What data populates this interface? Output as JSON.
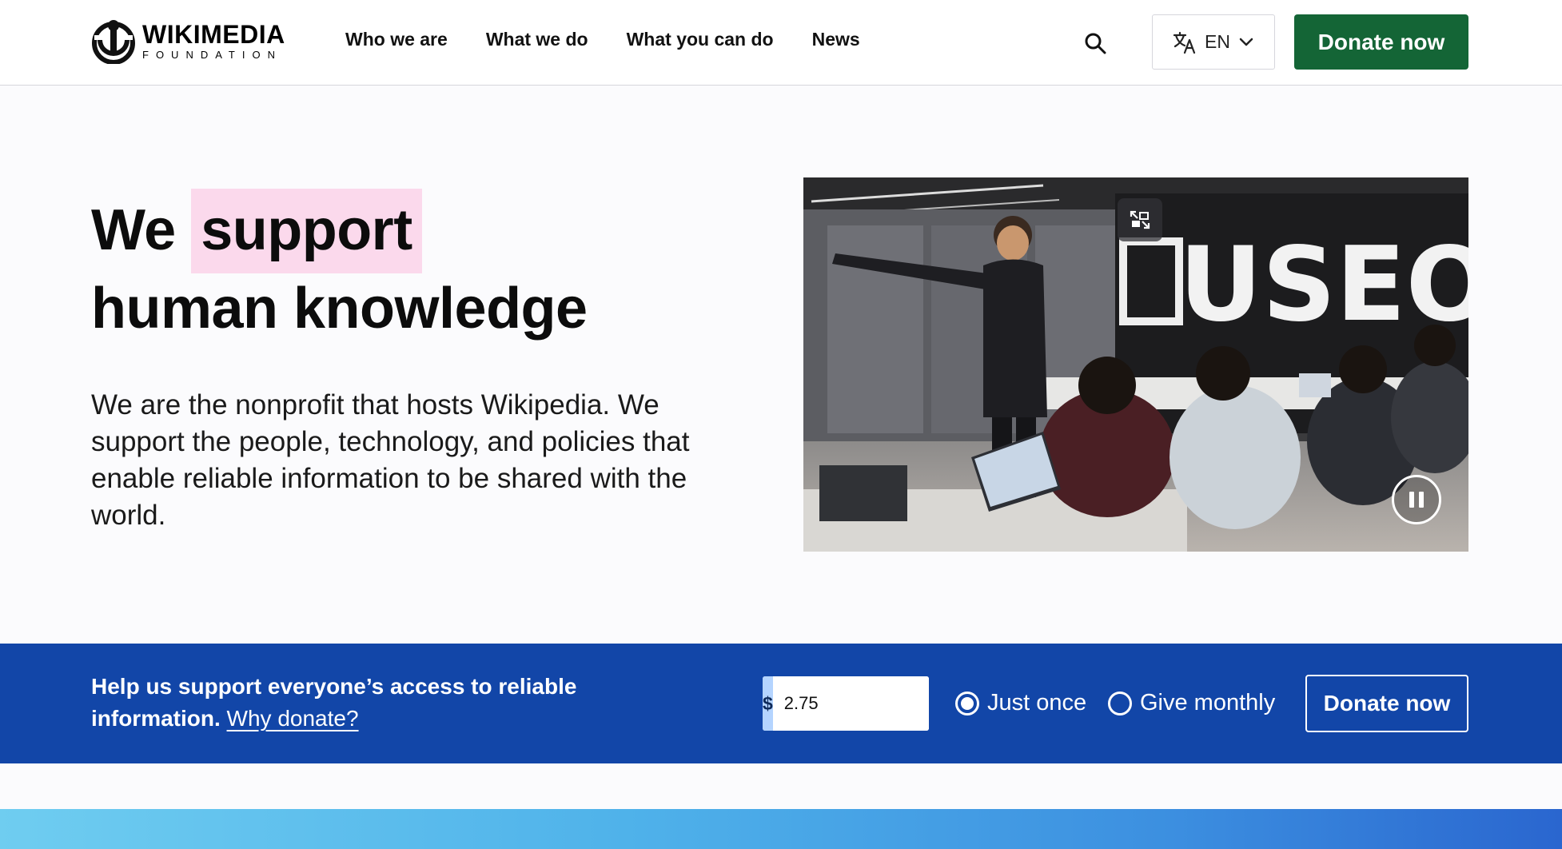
{
  "header": {
    "logo": {
      "name": "WIKIMEDIA",
      "sub": "FOUNDATION"
    },
    "nav": [
      "Who we are",
      "What we do",
      "What you can do",
      "News"
    ],
    "search_icon": "search-icon",
    "language": {
      "code": "EN",
      "icon": "translate-icon",
      "chevron": "chevron-down-icon"
    },
    "donate_label": "Donate now"
  },
  "hero": {
    "title_prefix": "We",
    "title_highlight": "support",
    "title_line2": "human knowledge",
    "description": "We are the nonprofit that hosts Wikipedia. We support the people, technology, and policies that enable reliable information to be shared with the world.",
    "video": {
      "pip_icon": "picture-in-picture-icon",
      "pause_icon": "pause-icon",
      "sign_text": "USEO"
    }
  },
  "banner": {
    "text": "Help us support everyone’s access to reliable information.",
    "link": "Why donate?",
    "currency": "$",
    "amount": "2.75",
    "options": [
      {
        "label": "Just once",
        "selected": true
      },
      {
        "label": "Give monthly",
        "selected": false
      }
    ],
    "donate_label": "Donate now"
  },
  "colors": {
    "donate_green": "#146536",
    "banner_blue": "#1246a8",
    "highlight_pink": "#fbd9ec",
    "currency_bg": "#b4d4ff"
  }
}
